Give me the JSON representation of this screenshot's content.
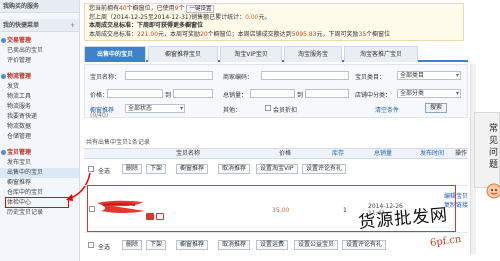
{
  "sidebar": {
    "top_item": "我购买的服务",
    "favorites": {
      "label": "我的快捷菜单",
      "add": "+"
    },
    "sections": [
      {
        "title": "交易管理",
        "items": [
          "已卖出的宝贝",
          "评价管理"
        ]
      },
      {
        "title": "物流管理",
        "items": [
          "发货",
          "物流工具",
          "物流服务",
          "我要寄快递",
          "物流数据",
          "仓储管理"
        ]
      },
      {
        "title": "宝贝管理",
        "items": [
          "发布宝贝",
          "出售中的宝贝",
          "橱窗推荐",
          "仓库中的宝贝",
          "体检中心",
          "历史宝贝记录"
        ]
      }
    ]
  },
  "notice": {
    "line1": {
      "prefix": "您当前拥有",
      "windows": "40",
      "mid": "个橱窗位，已使用",
      "used": "9",
      "suffix": "个",
      "button": "一键设置"
    },
    "line2": {
      "prefix": "您上周（2014-12-25至2014-12-31)销售额已累计统计：",
      "amount": "0.00",
      "unit": "元。"
    },
    "line3": {
      "text": "本周成交总标准：下周即可获得更多橱窗位"
    },
    "line4": {
      "prefix": "本周成交总标准：",
      "a1": "221.00",
      "m1": "元，本周可奖励",
      "w1": "20",
      "m2": "个橱窗位；本周店铺成交额达到",
      "a2": "5095.83",
      "m3": "元，下周可奖励",
      "w2": "35",
      "s": "个橱窗位"
    }
  },
  "tabs": [
    "出售中的宝贝",
    "橱窗推荐宝贝",
    "淘宝VIP宝贝",
    "淘宝服务宝",
    "淘宝客推广宝贝"
  ],
  "form": {
    "name_label": "宝贝名称：",
    "code_label": "商家编码：",
    "category_label": "宝贝类目：",
    "category_value": "全部类目",
    "price_label": "价格：",
    "to1": "到",
    "sales_label": "总销量：",
    "to2": "到",
    "shop_cat_label": "店铺中分类：",
    "shop_cat_value": "全部分类",
    "window_label": "橱窗推荐",
    "window_value": "全部状态",
    "window_count": "(0/40)",
    "other_label": "其他：",
    "member_price": "会员折扣",
    "clear": "清空条件",
    "search": "搜索"
  },
  "summary": "共有出售中宝贝1条记录",
  "table_head": {
    "name": "宝贝名称",
    "price": "价格",
    "stock": "库存",
    "sales": "总销量",
    "pubtime": "发布时间",
    "ops": "操作"
  },
  "bar": {
    "select_all": "全选",
    "delete": "删除",
    "delist": "下架",
    "window": "橱窗推荐",
    "cancel_window": "取消推荐",
    "set_vip": "设置淘宝VIP",
    "set_review": "设置评论有礼",
    "set_freight": "设置运费",
    "set_charity": "设置公益宝贝"
  },
  "product": {
    "price": "35.00",
    "stock": "1",
    "date": "2014-12-26",
    "time": "11:41",
    "edit": "编辑宝贝",
    "copy": "复制链接"
  },
  "float_panel": [
    "常",
    "见",
    "问",
    "题"
  ],
  "watermark": {
    "big": "货源批发网",
    "small": "6pf.cn"
  },
  "colors": {
    "accent_blue": "#3e82cc",
    "highlight_red": "#e53030",
    "price_orange": "#e3661e"
  }
}
